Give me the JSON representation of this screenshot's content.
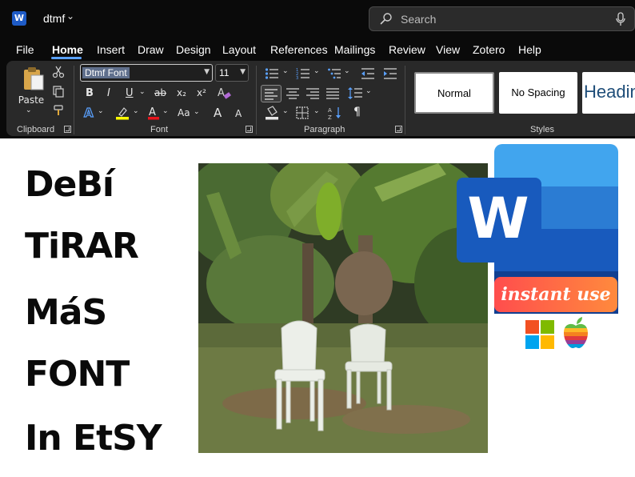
{
  "titlebar": {
    "app_icon_letter": "W",
    "doc_title": "dtmf",
    "chevron": "⌄",
    "search_placeholder": "Search"
  },
  "menu": {
    "tabs": [
      "File",
      "Home",
      "Insert",
      "Draw",
      "Design",
      "Layout",
      "References",
      "Mailings",
      "Review",
      "View",
      "Zotero",
      "Help"
    ],
    "active": "Home"
  },
  "ribbon": {
    "clipboard": {
      "label": "Clipboard",
      "paste": "Paste"
    },
    "font": {
      "label": "Font",
      "font_name": "Dtmf Font",
      "font_size": "11",
      "bold": "B",
      "italic": "I",
      "underline": "U",
      "strike": "ab",
      "subscript": "x₂",
      "superscript": "x²",
      "change_case": "Aa",
      "grow": "A",
      "shrink": "A"
    },
    "paragraph": {
      "label": "Paragraph",
      "pilcrow": "¶"
    },
    "styles": {
      "label": "Styles",
      "items": [
        "Normal",
        "No Spacing",
        "Headin"
      ]
    }
  },
  "document": {
    "lines": [
      "DeBí",
      "TiRAR",
      "MáS",
      "FONT",
      "In EtSY"
    ],
    "badge_text": "instant use",
    "badge_letter": "W"
  },
  "colors": {
    "accent": "#5aa1ff",
    "ribbon_bg": "#292929",
    "titlebar_bg": "#0a0a0a",
    "highlight": "#ffff00",
    "font_color": "#e8141c",
    "word_blue": "#185abd"
  },
  "icons": {
    "search": "search-icon",
    "mic": "mic-icon",
    "paste": "paste-icon",
    "cut": "scissors-icon",
    "copy": "copy-icon",
    "format_painter": "paintbrush-icon",
    "bullets": "bullet-list-icon",
    "numbering": "numbered-list-icon",
    "multilevel": "multilevel-list-icon",
    "sort": "sort-icon",
    "windows": "windows-logo-icon",
    "apple": "apple-logo-icon"
  }
}
